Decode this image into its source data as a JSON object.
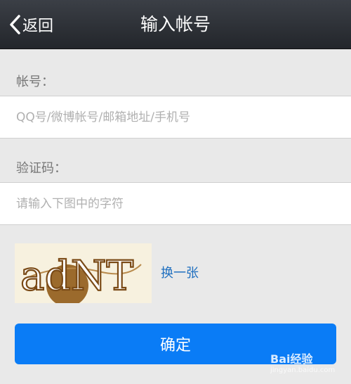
{
  "nav": {
    "back_label": "返回",
    "title": "输入帐号"
  },
  "account": {
    "label": "帐号：",
    "placeholder": "QQ号/微博帐号/邮箱地址/手机号"
  },
  "captcha": {
    "label": "验证码：",
    "placeholder": "请输入下图中的字符",
    "image_text": "adNT",
    "refresh_label": "换一张"
  },
  "confirm_label": "确定",
  "watermark": {
    "brand": "Bai经验",
    "url": "jingyan.baidu.com"
  },
  "colors": {
    "navbar": "#2c2f34",
    "background": "#e9e9e9",
    "primary": "#0a7cf6",
    "link": "#1f6fbf"
  }
}
